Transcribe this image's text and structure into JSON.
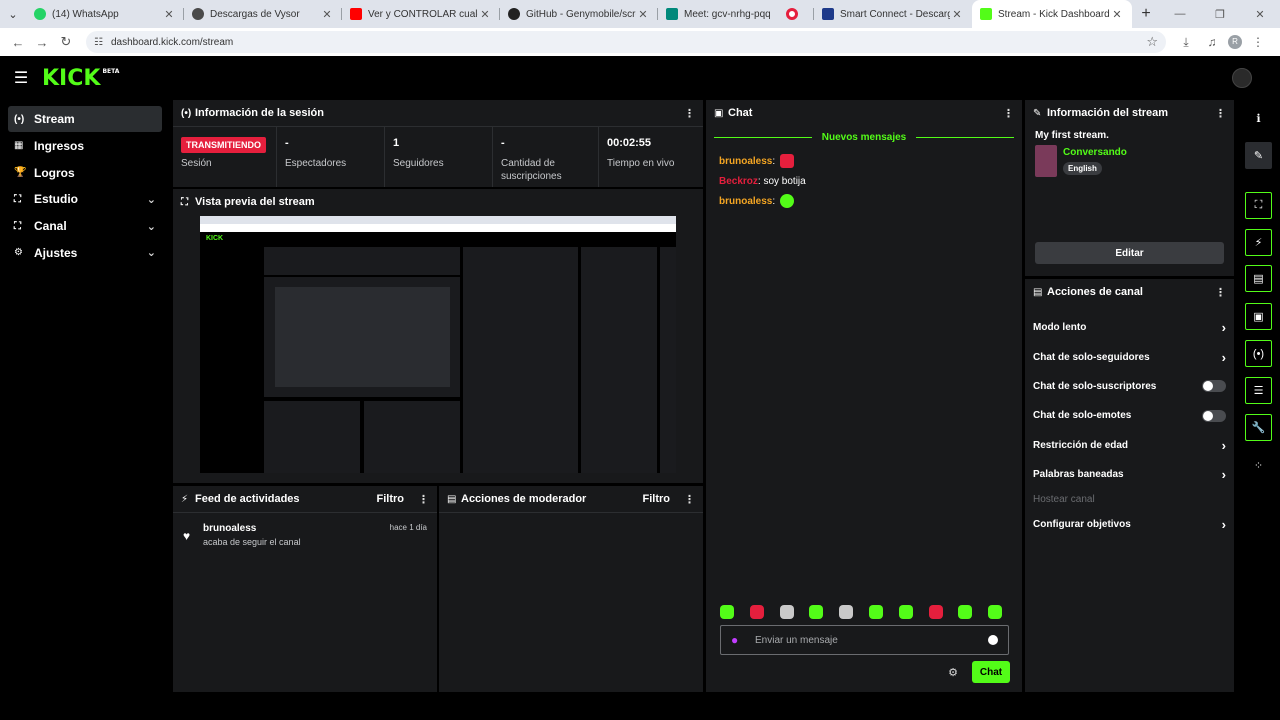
{
  "browser": {
    "tabs": [
      {
        "title": "(14) WhatsApp",
        "color": "#25d366"
      },
      {
        "title": "Descargas de Vysor",
        "color": "#4a4a4a"
      },
      {
        "title": "Ver y CONTROLAR cualquier Al",
        "color": "#ff0000"
      },
      {
        "title": "GitHub - Genymobile/scrcpy: D",
        "color": "#222222"
      },
      {
        "title": "Meet: gcv-nrhg-pqq",
        "color": "#00897b"
      },
      {
        "title": "",
        "color": "#e51f3d"
      },
      {
        "title": "Smart Connect - Descargar e in",
        "color": "#1e3a8a"
      },
      {
        "title": "Stream - Kick Dashboard",
        "color": "#53fc18"
      }
    ],
    "url": "dashboard.kick.com/stream",
    "profile_letter": "R"
  },
  "header": {
    "logo": "KICK",
    "beta": "BETA"
  },
  "sidebar": {
    "items": [
      {
        "label": "Stream",
        "icon": "(•)"
      },
      {
        "label": "Ingresos",
        "icon": "▦"
      },
      {
        "label": "Logros",
        "icon": "🏆"
      },
      {
        "label": "Estudio",
        "icon": "⛶"
      },
      {
        "label": "Canal",
        "icon": "⛶"
      },
      {
        "label": "Ajustes",
        "icon": "⚙"
      }
    ]
  },
  "session": {
    "title": "Información de la sesión",
    "badge": "TRANSMITIENDO",
    "stats": [
      {
        "value": "",
        "label": "Sesión"
      },
      {
        "value": "-",
        "label": "Espectadores"
      },
      {
        "value": "1",
        "label": "Seguidores"
      },
      {
        "value": "-",
        "label": "Cantidad de suscripciones"
      },
      {
        "value": "00:02:55",
        "label": "Tiempo en vivo"
      }
    ]
  },
  "preview": {
    "title": "Vista previa del stream"
  },
  "feed": {
    "title": "Feed de actividades",
    "filter": "Filtro",
    "items": [
      {
        "user": "brunoaless",
        "desc": "acaba de seguir el canal",
        "time": "hace 1 día"
      }
    ]
  },
  "mod": {
    "title": "Acciones de moderador",
    "filter": "Filtro"
  },
  "chat": {
    "title": "Chat",
    "new_messages": "Nuevos mensajes",
    "messages": [
      {
        "user": "brunoaless",
        "color": "#f5a623",
        "text": "",
        "emote": "#e51f3d"
      },
      {
        "user": "Beckroz",
        "color": "#e51f3d",
        "text": "soy botija",
        "emote": ""
      },
      {
        "user": "brunoaless",
        "color": "#f5a623",
        "text": "",
        "emote": "#53fc18"
      }
    ],
    "input_placeholder": "Enviar un mensaje",
    "send_label": "Chat"
  },
  "stream_info": {
    "title": "Información del stream",
    "stream_title": "My first stream.",
    "category": "Conversando",
    "language": "English",
    "edit_label": "Editar"
  },
  "channel_actions": {
    "title": "Acciones de canal",
    "items": [
      {
        "label": "Modo lento",
        "control": "chevron"
      },
      {
        "label": "Chat de solo-seguidores",
        "control": "chevron"
      },
      {
        "label": "Chat de solo-suscriptores",
        "control": "toggle"
      },
      {
        "label": "Chat de solo-emotes",
        "control": "toggle"
      },
      {
        "label": "Restricción de edad",
        "control": "chevron"
      },
      {
        "label": "Palabras baneadas",
        "control": "chevron"
      },
      {
        "label": "Hostear canal",
        "control": "disabled"
      },
      {
        "label": "Configurar objetivos",
        "control": "chevron"
      }
    ]
  },
  "colors": {
    "accent": "#53fc18",
    "live": "#e51f3d",
    "panel": "#18191b"
  }
}
